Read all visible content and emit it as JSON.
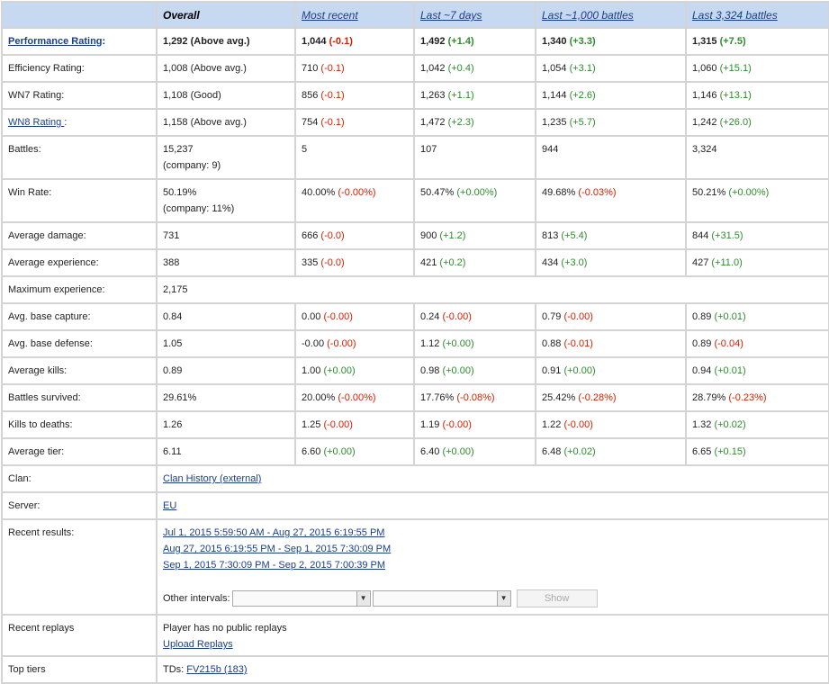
{
  "header": {
    "overall": "Overall",
    "most_recent": "Most recent",
    "last_7_days": "Last ~7 days",
    "last_1000": "Last ~1,000 battles",
    "last_all": "Last 3,324 battles"
  },
  "rows": {
    "performance": {
      "label": "Performance Rating",
      "colon": ":",
      "overall": "1,292 (Above avg.)",
      "c1v": "1,044 ",
      "c1d": "(-0.1)",
      "c2v": "1,492 ",
      "c2d": "(+1.4)",
      "c3v": "1,340 ",
      "c3d": "(+3.3)",
      "c4v": "1,315 ",
      "c4d": "(+7.5)"
    },
    "efficiency": {
      "label": "Efficiency Rating:",
      "overall": "1,008 (Above avg.)",
      "c1v": "710 ",
      "c1d": "(-0.1)",
      "c2v": "1,042 ",
      "c2d": "(+0.4)",
      "c3v": "1,054 ",
      "c3d": "(+3.1)",
      "c4v": "1,060 ",
      "c4d": "(+15.1)"
    },
    "wn7": {
      "label": "WN7 Rating:",
      "overall": "1,108 (Good)",
      "c1v": "856 ",
      "c1d": "(-0.1)",
      "c2v": "1,263 ",
      "c2d": "(+1.1)",
      "c3v": "1,144 ",
      "c3d": "(+2.6)",
      "c4v": "1,146 ",
      "c4d": "(+13.1)"
    },
    "wn8": {
      "label": "WN8 Rating ",
      "colon": ":",
      "overall": "1,158 (Above avg.)",
      "c1v": "754 ",
      "c1d": "(-0.1)",
      "c2v": "1,472 ",
      "c2d": "(+2.3)",
      "c3v": "1,235 ",
      "c3d": "(+5.7)",
      "c4v": "1,242 ",
      "c4d": "(+26.0)"
    },
    "battles": {
      "label": "Battles:",
      "overall": "15,237",
      "overall2": "(company: 9)",
      "c1": "5",
      "c2": "107",
      "c3": "944",
      "c4": "3,324"
    },
    "winrate": {
      "label": "Win Rate:",
      "overall": "50.19%",
      "overall2": "(company: 11%)",
      "c1v": "40.00% ",
      "c1d": "(-0.00%)",
      "c2v": "50.47% ",
      "c2d": "(+0.00%)",
      "c3v": "49.68% ",
      "c3d": "(-0.03%)",
      "c4v": "50.21% ",
      "c4d": "(+0.00%)"
    },
    "avg_damage": {
      "label": "Average damage:",
      "overall": "731",
      "c1v": "666 ",
      "c1d": "(-0.0)",
      "c2v": "900 ",
      "c2d": "(+1.2)",
      "c3v": "813 ",
      "c3d": "(+5.4)",
      "c4v": "844 ",
      "c4d": "(+31.5)"
    },
    "avg_exp": {
      "label": "Average experience:",
      "overall": "388",
      "c1v": "335 ",
      "c1d": "(-0.0)",
      "c2v": "421 ",
      "c2d": "(+0.2)",
      "c3v": "434 ",
      "c3d": "(+3.0)",
      "c4v": "427 ",
      "c4d": "(+11.0)"
    },
    "max_exp": {
      "label": "Maximum experience:",
      "overall": "2,175"
    },
    "base_capture": {
      "label": "Avg. base capture:",
      "overall": "0.84",
      "c1v": "0.00 ",
      "c1d": "(-0.00)",
      "c2v": "0.24 ",
      "c2d": "(-0.00)",
      "c3v": "0.79 ",
      "c3d": "(-0.00)",
      "c4v": "0.89 ",
      "c4d": "(+0.01)"
    },
    "base_defense": {
      "label": "Avg. base defense:",
      "overall": "1.05",
      "c1v": "-0.00 ",
      "c1d": "(-0.00)",
      "c2v": "1.12 ",
      "c2d": "(+0.00)",
      "c3v": "0.88 ",
      "c3d": "(-0.01)",
      "c4v": "0.89 ",
      "c4d": "(-0.04)"
    },
    "avg_kills": {
      "label": "Average kills:",
      "overall": "0.89",
      "c1v": "1.00 ",
      "c1d": "(+0.00)",
      "c2v": "0.98 ",
      "c2d": "(+0.00)",
      "c3v": "0.91 ",
      "c3d": "(+0.00)",
      "c4v": "0.94 ",
      "c4d": "(+0.01)"
    },
    "survived": {
      "label": "Battles survived:",
      "overall": "29.61%",
      "c1v": "20.00% ",
      "c1d": "(-0.00%)",
      "c2v": "17.76% ",
      "c2d": "(-0.08%)",
      "c3v": "25.42% ",
      "c3d": "(-0.28%)",
      "c4v": "28.79% ",
      "c4d": "(-0.23%)"
    },
    "kd": {
      "label": "Kills to deaths:",
      "overall": "1.26",
      "c1v": "1.25 ",
      "c1d": "(-0.00)",
      "c2v": "1.19 ",
      "c2d": "(-0.00)",
      "c3v": "1.22 ",
      "c3d": "(-0.00)",
      "c4v": "1.32 ",
      "c4d": "(+0.02)"
    },
    "avg_tier": {
      "label": "Average tier:",
      "overall": "6.11",
      "c1v": "6.60 ",
      "c1d": "(+0.00)",
      "c2v": "6.40 ",
      "c2d": "(+0.00)",
      "c3v": "6.48 ",
      "c3d": "(+0.02)",
      "c4v": "6.65 ",
      "c4d": "(+0.15)"
    },
    "clan": {
      "label": "Clan:",
      "link": "Clan History (external)"
    },
    "server": {
      "label": "Server:",
      "link": "EU"
    },
    "recent_results": {
      "label": "Recent results:",
      "links": [
        "Jul 1, 2015 5:59:50 AM - Aug 27, 2015 6:19:55 PM",
        "Aug 27, 2015 6:19:55 PM - Sep 1, 2015 7:30:09 PM",
        "Sep 1, 2015 7:30:09 PM - Sep 2, 2015 7:00:39 PM"
      ],
      "other_intervals_label": "Other intervals:",
      "select_from_value": "",
      "select_to_value": "",
      "show_button": "Show"
    },
    "recent_replays": {
      "label": "Recent replays",
      "text": "Player has no public replays",
      "link": "Upload Replays"
    },
    "top_tiers": {
      "label": "Top tiers",
      "prefix": "TDs: ",
      "link": "FV215b (183)"
    }
  },
  "colors": {
    "header_bg": "#c6d9f1",
    "link": "#1a3e8a",
    "negative": "#cc2200",
    "positive": "#2e8b2e",
    "border": "#d4d4d4"
  },
  "icons": {
    "dropdown_arrow": "chevron-down-icon"
  }
}
